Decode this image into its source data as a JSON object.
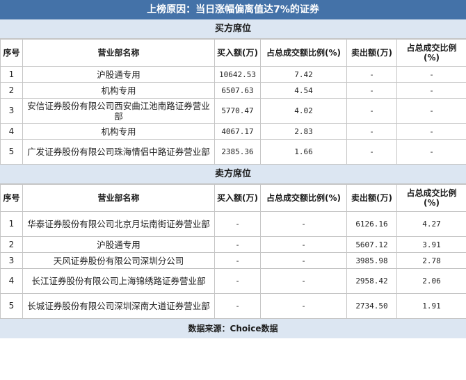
{
  "title": "上榜原因：当日涨幅偏离值达7%的证券",
  "buy_section": {
    "label": "买方席位",
    "headers": [
      "序号",
      "营业部名称",
      "买入额(万)",
      "占总成交额比例(%)",
      "卖出额(万)",
      "占总成交比例(%)"
    ],
    "rows": [
      {
        "no": "1",
        "name": "沪股通专用",
        "buy": "10642.53",
        "buy_pct": "7.42",
        "sell": "-",
        "sell_pct": "-"
      },
      {
        "no": "2",
        "name": "机构专用",
        "buy": "6507.63",
        "buy_pct": "4.54",
        "sell": "-",
        "sell_pct": "-"
      },
      {
        "no": "3",
        "name": "安信证券股份有限公司西安曲江池南路证券营业部",
        "buy": "5770.47",
        "buy_pct": "4.02",
        "sell": "-",
        "sell_pct": "-"
      },
      {
        "no": "4",
        "name": "机构专用",
        "buy": "4067.17",
        "buy_pct": "2.83",
        "sell": "-",
        "sell_pct": "-"
      },
      {
        "no": "5",
        "name": "广发证券股份有限公司珠海情侣中路证券营业部",
        "buy": "2385.36",
        "buy_pct": "1.66",
        "sell": "-",
        "sell_pct": "-"
      }
    ]
  },
  "sell_section": {
    "label": "卖方席位",
    "headers": [
      "序号",
      "营业部名称",
      "买入额(万)",
      "占总成交额比例(%)",
      "卖出额(万)",
      "占总成交比例(%)"
    ],
    "rows": [
      {
        "no": "1",
        "name": "华泰证券股份有限公司北京月坛南街证券营业部",
        "buy": "-",
        "buy_pct": "-",
        "sell": "6126.16",
        "sell_pct": "4.27"
      },
      {
        "no": "2",
        "name": "沪股通专用",
        "buy": "-",
        "buy_pct": "-",
        "sell": "5607.12",
        "sell_pct": "3.91"
      },
      {
        "no": "3",
        "name": "天风证券股份有限公司深圳分公司",
        "buy": "-",
        "buy_pct": "-",
        "sell": "3985.98",
        "sell_pct": "2.78"
      },
      {
        "no": "4",
        "name": "长江证券股份有限公司上海锦绣路证券营业部",
        "buy": "-",
        "buy_pct": "-",
        "sell": "2958.42",
        "sell_pct": "2.06"
      },
      {
        "no": "5",
        "name": "长城证券股份有限公司深圳深南大道证券营业部",
        "buy": "-",
        "buy_pct": "-",
        "sell": "2734.50",
        "sell_pct": "1.91"
      }
    ]
  },
  "footer": "数据来源：Choice数据"
}
